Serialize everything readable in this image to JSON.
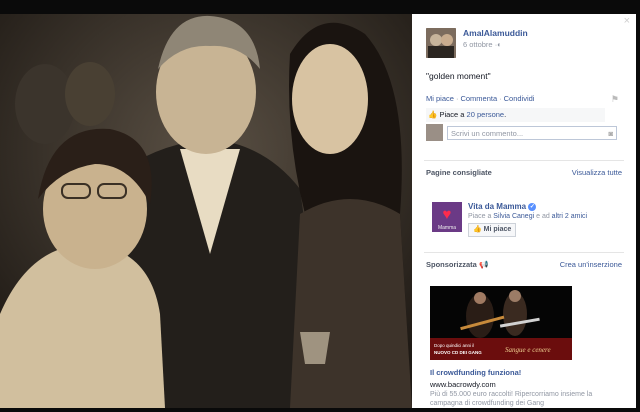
{
  "viewer": {
    "close_glyph": "×"
  },
  "post": {
    "author": "AmalAlamuddin",
    "date": "6 ottobre",
    "audience_icon": "globe-icon",
    "caption": "\"golden moment\"",
    "actions": [
      "Mi piace",
      "Commenta",
      "Condividi"
    ],
    "likes_prefix": "Piace a ",
    "likes_link": "20 persone",
    "likes_suffix": ".",
    "comment_placeholder": "Scrivi un commento..."
  },
  "suggested": {
    "title": "Pagine consigliate",
    "see_all": "Visualizza tutte",
    "page_name": "Vita da Mamma",
    "page_logo_text": "Mamma",
    "meta_prefix": "Piace a ",
    "meta_friend": "Silvia Canegi",
    "meta_middle": " e ad ",
    "meta_others": "altri 2 amici",
    "like_button": "Mi piace"
  },
  "sponsored": {
    "title": "Sponsorizzata",
    "create_link": "Crea un'inserzione",
    "ad_banner_left_1": "Dopo quindici anni il",
    "ad_banner_left_2": "NUOVO CD DEI GANG",
    "ad_banner_right": "Sangue e cenere",
    "ad_title": "Il crowdfunding funziona!",
    "ad_url": "www.bacrowdy.com",
    "ad_desc": "Più di 55.000 euro raccolti! Ripercorriamo insieme la campagna di crowdfunding dei Gang"
  },
  "colors": {
    "link": "#3b5998",
    "muted": "#9197a3",
    "ad_red": "#c0161b"
  }
}
